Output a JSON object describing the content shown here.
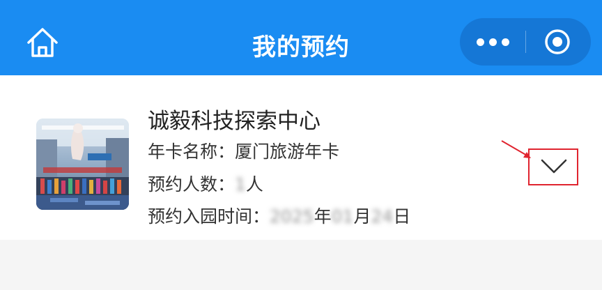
{
  "header": {
    "title": "我的预约",
    "icons": {
      "home": "home-icon",
      "more": "more-dots-icon",
      "close": "close-circle-icon"
    }
  },
  "reservation": {
    "venue_name": "诚毅科技探索中心",
    "card_label": "年卡名称：",
    "card_value": "厦门旅游年卡",
    "people_label": "预约人数：",
    "people_count": "1",
    "people_unit": "人",
    "date_label": "预约入园时间：",
    "date_year": "2025",
    "date_year_unit": "年",
    "date_month": "01",
    "date_month_unit": "月",
    "date_day": "24",
    "date_day_unit": "日"
  },
  "colors": {
    "header_bg": "#1a8cf2",
    "capsule_bg": "#1577d6",
    "highlight_red": "#e0242f"
  }
}
